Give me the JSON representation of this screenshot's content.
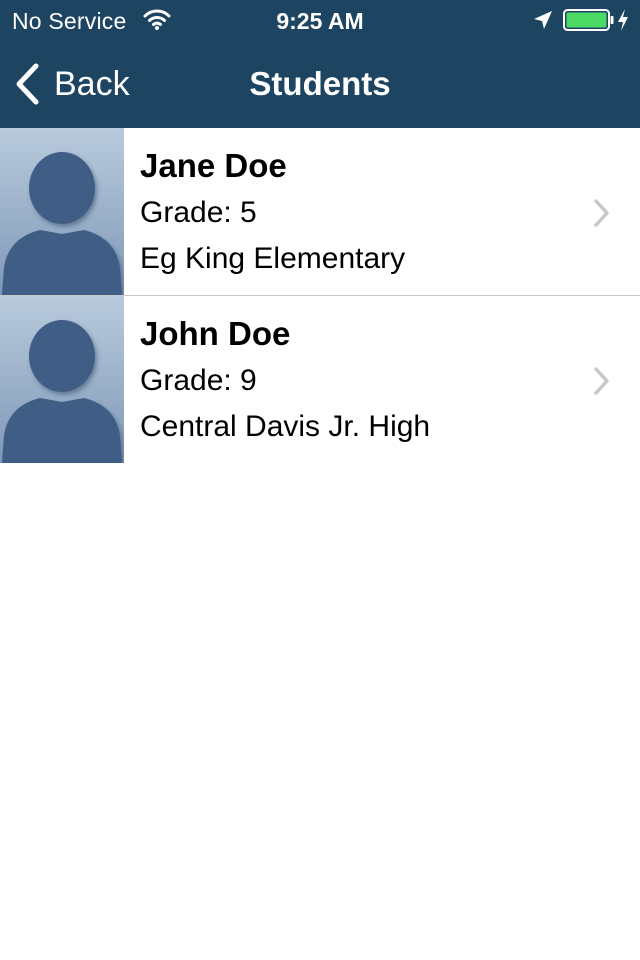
{
  "status_bar": {
    "carrier": "No Service",
    "time": "9:25 AM",
    "icons": [
      "wifi-icon",
      "location-arrow-icon",
      "battery-icon",
      "charging-bolt-icon"
    ],
    "battery_level": 1.0
  },
  "nav_bar": {
    "back_label": "Back",
    "title": "Students",
    "back_icon": "chevron-left-icon"
  },
  "students": [
    {
      "name": "Jane Doe",
      "grade": "Grade: 5",
      "school": "Eg King Elementary",
      "avatar_icon": "avatar-placeholder-icon",
      "accessory_icon": "chevron-right-icon"
    },
    {
      "name": "John Doe",
      "grade": "Grade: 9",
      "school": "Central Davis Jr. High",
      "avatar_icon": "avatar-placeholder-icon",
      "accessory_icon": "chevron-right-icon"
    }
  ],
  "colors": {
    "nav_background": "#1d4461",
    "nav_text": "#ffffff",
    "battery_fill": "#4cd964",
    "separator": "#c8c7cc",
    "chevron": "#c7c7cc",
    "avatar_silhouette": "#3f5d86"
  }
}
